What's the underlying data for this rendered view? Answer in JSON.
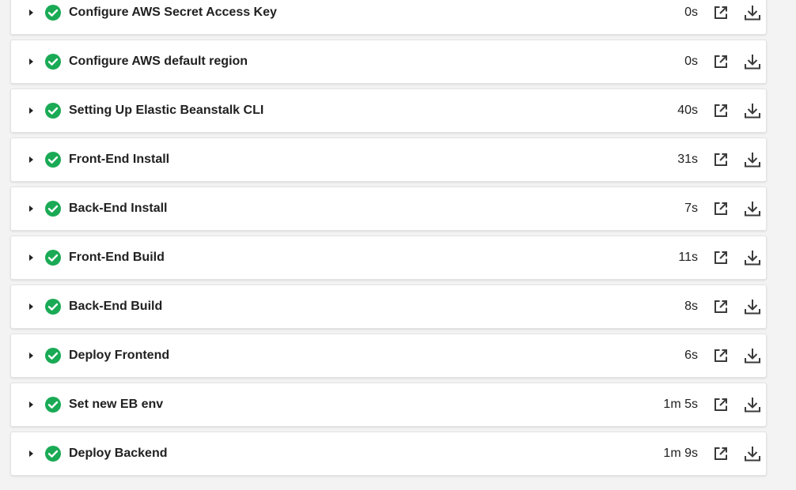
{
  "colors": {
    "success": "#1aaa55",
    "text": "#212121",
    "icon": "#3a3a3a",
    "background": "#f3f3f3"
  },
  "icons": {
    "caret": "caret-right-icon",
    "status": "check-circle-icon",
    "open": "external-link-icon",
    "download": "download-icon"
  },
  "steps": [
    {
      "name": "Configure AWS Secret Access Key",
      "duration": "0s"
    },
    {
      "name": "Configure AWS default region",
      "duration": "0s"
    },
    {
      "name": "Setting Up Elastic Beanstalk CLI",
      "duration": "40s"
    },
    {
      "name": "Front-End Install",
      "duration": "31s"
    },
    {
      "name": "Back-End Install",
      "duration": "7s"
    },
    {
      "name": "Front-End Build",
      "duration": "11s"
    },
    {
      "name": "Back-End Build",
      "duration": "8s"
    },
    {
      "name": "Deploy Frontend",
      "duration": "6s"
    },
    {
      "name": "Set new EB env",
      "duration": "1m 5s"
    },
    {
      "name": "Deploy Backend",
      "duration": "1m 9s"
    }
  ]
}
